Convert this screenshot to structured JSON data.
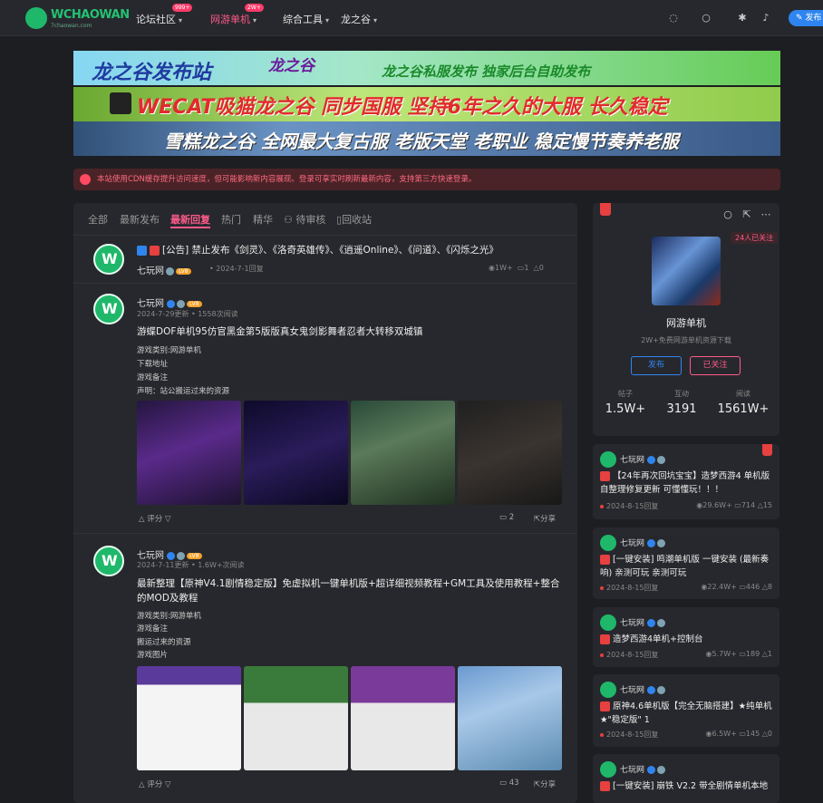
{
  "header": {
    "logo_text": "WCHAOWAN",
    "logo_sub": "7chaowan.com",
    "nav": [
      {
        "label": "论坛社区",
        "badge": "999+"
      },
      {
        "label": "网游单机",
        "badge": "2W+"
      },
      {
        "label": "综合工具",
        "badge": ""
      },
      {
        "label": "龙之谷",
        "badge": ""
      }
    ],
    "publish_label": "发布"
  },
  "banners": [
    {
      "t1": "龙之谷发布站",
      "t2": "龙之谷",
      "t3": "龙之谷私服发布  独家后台自助发布"
    },
    {
      "t1": "WECAT吸猫龙之谷  同步国服  坚持6年之久的大服  长久稳定"
    },
    {
      "t1": "雪糕龙之谷  全网最大复古服  老版天堂  老职业  稳定慢节奏养老服"
    }
  ],
  "notice": "本站使用CDN缓存提升访问速度，但可能影响新内容展现。登录可享实时刷新最新内容，支持第三方快速登录。",
  "tabs": [
    "全部",
    "最新发布",
    "最新回复",
    "热门",
    "精华",
    "待审核",
    "回收站"
  ],
  "posts": [
    {
      "title": "[公告] 禁止发布《剑灵》、《洛奇英雄传》、《逍遥Online》、《问道》、《闪烁之光》",
      "author": "七玩网",
      "level": "LV8",
      "time": "2024-7-1回复",
      "views": "1W+",
      "comments": "1",
      "likes": "0"
    },
    {
      "author": "七玩网",
      "level": "LV8",
      "time": "2024-7-29更新",
      "reads": "1558次阅读",
      "title": "游蝶DOF单机95仿官黑金第5版版真女鬼剑影舞者忍者大转移双城镇",
      "lines": [
        "游戏类别:网游单机",
        "下载地址",
        "游戏备注",
        "声明：站公搬运过来的资源"
      ],
      "rate_label": "评分",
      "comments": "2",
      "share": "分享"
    },
    {
      "author": "七玩网",
      "level": "LV8",
      "time": "2024-7-11更新",
      "reads": "1.6W+次阅读",
      "title": "最新整理【原神V4.1剧情稳定版】免虚拟机一键单机版+超详细视频教程+GM工具及使用教程+整合的MOD及教程",
      "lines": [
        "游戏类别:网游单机",
        "游戏备注",
        "搬运过来的资源",
        "游戏图片"
      ],
      "rate_label": "评分",
      "comments": "43",
      "share": "分享"
    }
  ],
  "forum": {
    "followers": "24人已关注",
    "name": "网游单机",
    "desc": "2W+免费网游单机资源下载",
    "publish": "发布",
    "followed": "已关注",
    "stats": [
      {
        "label": "帖子",
        "value": "1.5W+"
      },
      {
        "label": "互动",
        "value": "3191"
      },
      {
        "label": "阅读",
        "value": "1561W+"
      }
    ]
  },
  "side_posts": [
    {
      "author": "七玩网",
      "title": "【24年再次回坑宝宝】造梦西游4 单机版 自整理修复更新 可懂懂玩！！！",
      "time": "2024-8-15回复",
      "views": "29.6W+",
      "comments": "714",
      "likes": "15"
    },
    {
      "author": "七玩网",
      "title": "[一键安装] 鸣潮单机版 一键安装 (最新奏响) 亲测可玩 亲测可玩",
      "time": "2024-8-15回复",
      "views": "22.4W+",
      "comments": "446",
      "likes": "8"
    },
    {
      "author": "七玩网",
      "title": "造梦西游4单机+控制台",
      "time": "2024-8-15回复",
      "views": "5.7W+",
      "comments": "189",
      "likes": "1"
    },
    {
      "author": "七玩网",
      "title": "原神4.6单机版【完全无脑搭建】★纯单机★\"稳定版\" 1",
      "time": "2024-8-15回复",
      "views": "6.5W+",
      "comments": "145",
      "likes": "0"
    },
    {
      "author": "七玩网",
      "title": "[一键安装] 崩铁 V2.2 带全剧情单机本地"
    }
  ]
}
